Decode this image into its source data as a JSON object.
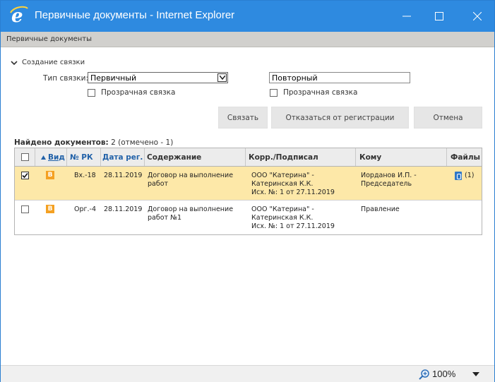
{
  "window": {
    "title": "Первичные документы - Internet Explorer",
    "accent_color": "#2e8ae0"
  },
  "page_header": "Первичные документы",
  "section": {
    "title": "Создание связки",
    "link_type_label": "Тип связки:",
    "link_type_value": "Первичный",
    "repeat_value": "Повторный",
    "transparent_label_1": "Прозрачная связка",
    "transparent_label_2": "Прозрачная связка"
  },
  "buttons": {
    "link": "Связать",
    "decline": "Отказаться от регистрации",
    "cancel": "Отмена"
  },
  "found": {
    "label": "Найдено документов:",
    "count": "2 (отмечено - 1)"
  },
  "table": {
    "headers": {
      "type": "Вид",
      "rk": "№ РК",
      "date": "Дата рег.",
      "content": "Содержание",
      "corr": "Корр./Подписал",
      "to": "Кому",
      "files": "Файлы"
    },
    "rows": [
      {
        "checked": true,
        "badge": "В",
        "rk": "Вх.-18",
        "date": "28.11.2019",
        "content_1": "Договор на выполнение",
        "content_2": "работ",
        "corr_1": "ООО \"Катерина\" -",
        "corr_2": "Катеринская К.К.",
        "corr_3": "Исх. №: 1 от 27.11.2019",
        "to_1": "Иорданов И.П. -",
        "to_2": "Председатель",
        "files": "(1)"
      },
      {
        "checked": false,
        "badge": "В",
        "rk": "Орг.-4",
        "date": "28.11.2019",
        "content_1": "Договор на выполнение",
        "content_2": "работ №1",
        "corr_1": "ООО \"Катерина\" -",
        "corr_2": "Катеринская К.К.",
        "corr_3": "Исх. №: 1 от 27.11.2019",
        "to_1": "Правление",
        "to_2": "",
        "files": ""
      }
    ]
  },
  "status": {
    "zoom": "100%"
  }
}
